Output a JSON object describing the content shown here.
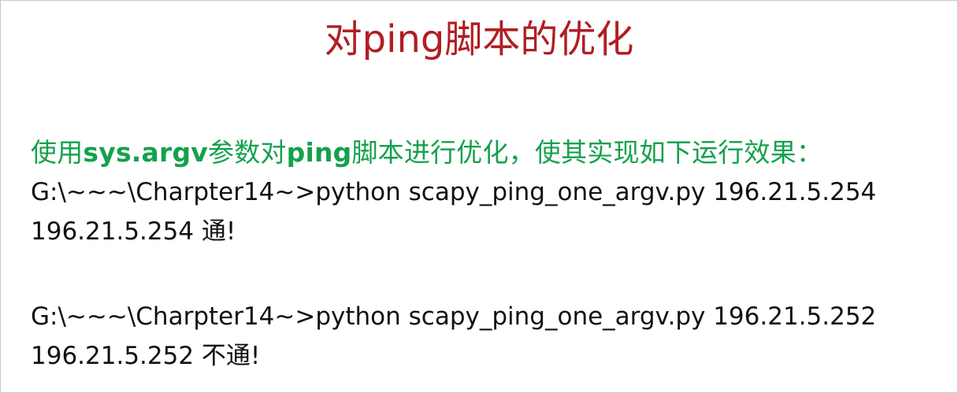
{
  "slide": {
    "title": "对ping脚本的优化",
    "intro": {
      "part1": "使用",
      "bold1": "sys.argv",
      "part2": "参数对",
      "bold2": "ping",
      "part3": "脚本进行优化，使其实现如下运行效果："
    },
    "output_lines": [
      "G:\\~~~\\Charpter14~>python scapy_ping_one_argv.py 196.21.5.254",
      "196.21.5.254 通!",
      "",
      "G:\\~~~\\Charpter14~>python scapy_ping_one_argv.py 196.21.5.252",
      "196.21.5.252 不通!"
    ]
  },
  "colors": {
    "title": "#b01e23",
    "intro": "#14a14c",
    "body_text": "#111111"
  }
}
